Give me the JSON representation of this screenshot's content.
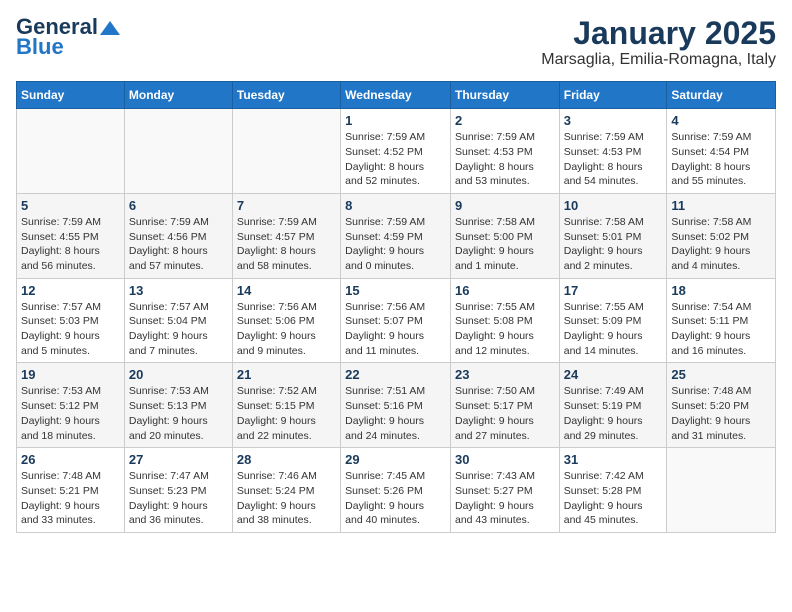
{
  "logo": {
    "text_general": "General",
    "text_blue": "Blue"
  },
  "title": "January 2025",
  "subtitle": "Marsaglia, Emilia-Romagna, Italy",
  "weekdays": [
    "Sunday",
    "Monday",
    "Tuesday",
    "Wednesday",
    "Thursday",
    "Friday",
    "Saturday"
  ],
  "weeks": [
    [
      {
        "day": "",
        "info": ""
      },
      {
        "day": "",
        "info": ""
      },
      {
        "day": "",
        "info": ""
      },
      {
        "day": "1",
        "info": "Sunrise: 7:59 AM\nSunset: 4:52 PM\nDaylight: 8 hours\nand 52 minutes."
      },
      {
        "day": "2",
        "info": "Sunrise: 7:59 AM\nSunset: 4:53 PM\nDaylight: 8 hours\nand 53 minutes."
      },
      {
        "day": "3",
        "info": "Sunrise: 7:59 AM\nSunset: 4:53 PM\nDaylight: 8 hours\nand 54 minutes."
      },
      {
        "day": "4",
        "info": "Sunrise: 7:59 AM\nSunset: 4:54 PM\nDaylight: 8 hours\nand 55 minutes."
      }
    ],
    [
      {
        "day": "5",
        "info": "Sunrise: 7:59 AM\nSunset: 4:55 PM\nDaylight: 8 hours\nand 56 minutes."
      },
      {
        "day": "6",
        "info": "Sunrise: 7:59 AM\nSunset: 4:56 PM\nDaylight: 8 hours\nand 57 minutes."
      },
      {
        "day": "7",
        "info": "Sunrise: 7:59 AM\nSunset: 4:57 PM\nDaylight: 8 hours\nand 58 minutes."
      },
      {
        "day": "8",
        "info": "Sunrise: 7:59 AM\nSunset: 4:59 PM\nDaylight: 9 hours\nand 0 minutes."
      },
      {
        "day": "9",
        "info": "Sunrise: 7:58 AM\nSunset: 5:00 PM\nDaylight: 9 hours\nand 1 minute."
      },
      {
        "day": "10",
        "info": "Sunrise: 7:58 AM\nSunset: 5:01 PM\nDaylight: 9 hours\nand 2 minutes."
      },
      {
        "day": "11",
        "info": "Sunrise: 7:58 AM\nSunset: 5:02 PM\nDaylight: 9 hours\nand 4 minutes."
      }
    ],
    [
      {
        "day": "12",
        "info": "Sunrise: 7:57 AM\nSunset: 5:03 PM\nDaylight: 9 hours\nand 5 minutes."
      },
      {
        "day": "13",
        "info": "Sunrise: 7:57 AM\nSunset: 5:04 PM\nDaylight: 9 hours\nand 7 minutes."
      },
      {
        "day": "14",
        "info": "Sunrise: 7:56 AM\nSunset: 5:06 PM\nDaylight: 9 hours\nand 9 minutes."
      },
      {
        "day": "15",
        "info": "Sunrise: 7:56 AM\nSunset: 5:07 PM\nDaylight: 9 hours\nand 11 minutes."
      },
      {
        "day": "16",
        "info": "Sunrise: 7:55 AM\nSunset: 5:08 PM\nDaylight: 9 hours\nand 12 minutes."
      },
      {
        "day": "17",
        "info": "Sunrise: 7:55 AM\nSunset: 5:09 PM\nDaylight: 9 hours\nand 14 minutes."
      },
      {
        "day": "18",
        "info": "Sunrise: 7:54 AM\nSunset: 5:11 PM\nDaylight: 9 hours\nand 16 minutes."
      }
    ],
    [
      {
        "day": "19",
        "info": "Sunrise: 7:53 AM\nSunset: 5:12 PM\nDaylight: 9 hours\nand 18 minutes."
      },
      {
        "day": "20",
        "info": "Sunrise: 7:53 AM\nSunset: 5:13 PM\nDaylight: 9 hours\nand 20 minutes."
      },
      {
        "day": "21",
        "info": "Sunrise: 7:52 AM\nSunset: 5:15 PM\nDaylight: 9 hours\nand 22 minutes."
      },
      {
        "day": "22",
        "info": "Sunrise: 7:51 AM\nSunset: 5:16 PM\nDaylight: 9 hours\nand 24 minutes."
      },
      {
        "day": "23",
        "info": "Sunrise: 7:50 AM\nSunset: 5:17 PM\nDaylight: 9 hours\nand 27 minutes."
      },
      {
        "day": "24",
        "info": "Sunrise: 7:49 AM\nSunset: 5:19 PM\nDaylight: 9 hours\nand 29 minutes."
      },
      {
        "day": "25",
        "info": "Sunrise: 7:48 AM\nSunset: 5:20 PM\nDaylight: 9 hours\nand 31 minutes."
      }
    ],
    [
      {
        "day": "26",
        "info": "Sunrise: 7:48 AM\nSunset: 5:21 PM\nDaylight: 9 hours\nand 33 minutes."
      },
      {
        "day": "27",
        "info": "Sunrise: 7:47 AM\nSunset: 5:23 PM\nDaylight: 9 hours\nand 36 minutes."
      },
      {
        "day": "28",
        "info": "Sunrise: 7:46 AM\nSunset: 5:24 PM\nDaylight: 9 hours\nand 38 minutes."
      },
      {
        "day": "29",
        "info": "Sunrise: 7:45 AM\nSunset: 5:26 PM\nDaylight: 9 hours\nand 40 minutes."
      },
      {
        "day": "30",
        "info": "Sunrise: 7:43 AM\nSunset: 5:27 PM\nDaylight: 9 hours\nand 43 minutes."
      },
      {
        "day": "31",
        "info": "Sunrise: 7:42 AM\nSunset: 5:28 PM\nDaylight: 9 hours\nand 45 minutes."
      },
      {
        "day": "",
        "info": ""
      }
    ]
  ]
}
